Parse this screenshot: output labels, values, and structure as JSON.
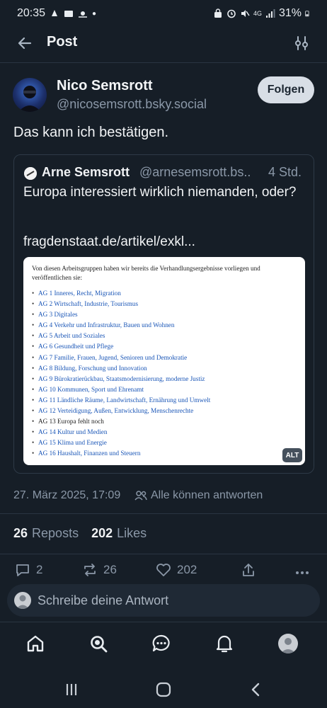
{
  "status_bar": {
    "time": "20:35",
    "battery": "31%",
    "network": "4G"
  },
  "header": {
    "title": "Post"
  },
  "post": {
    "author_name": "Nico Semsrott",
    "author_handle": "@nicosemsrott.bsky.social",
    "follow_label": "Folgen",
    "text": "Das kann ich bestätigen.",
    "date": "27. März 2025, 17:09",
    "reply_setting": "Alle können antworten",
    "reposts_count": "26",
    "reposts_label": "Reposts",
    "likes_count": "202",
    "likes_label": "Likes"
  },
  "quote": {
    "author_name": "Arne Semsrott",
    "author_handle": "@arnesemsrott.bs..",
    "time": "4 Std.",
    "text": "Europa interessiert wirklich niemanden, oder?",
    "link": "fragdenstaat.de/artikel/exkl...",
    "alt_badge": "ALT",
    "image": {
      "intro": "Von diesen Arbeitsgruppen haben wir bereits die Verhandlungsergebnisse vorliegen und veröffentlichen sie:",
      "items": [
        "AG 1 Inneres, Recht, Migration",
        "AG 2 Wirtschaft, Industrie, Tourismus",
        "AG 3 Digitales",
        "AG 4 Verkehr und Infrastruktur, Bauen und Wohnen",
        "AG 5 Arbeit und Soziales",
        "AG 6 Gesundheit und Pflege",
        "AG 7 Familie, Frauen, Jugend, Senioren und Demokratie",
        "AG 8 Bildung, Forschung und Innovation",
        "AG 9 Bürokratierückbau, Staatsmodernisierung, moderne Justiz",
        "AG 10 Kommunen, Sport und Ehrenamt",
        "AG 11 Ländliche Räume, Landwirtschaft, Ernährung und Umwelt",
        "AG 12 Verteidigung, Außen, Entwicklung, Menschenrechte",
        "AG 13 Europa fehlt noch",
        "AG 14 Kultur und Medien",
        "AG 15 Klima und Energie",
        "AG 16 Haushalt, Finanzen und Steuern"
      ]
    }
  },
  "actions": {
    "replies": "2",
    "reposts": "26",
    "likes": "202"
  },
  "reply_bar": {
    "placeholder": "Schreibe deine Antwort"
  },
  "colors": {
    "background": "#161e27",
    "text": "#f1f3f5",
    "muted": "#8b98a8",
    "link": "#1a56b7",
    "follow_button": "#d8dee6"
  },
  "icons": {
    "back": "arrow-left-icon",
    "filter": "sliders-icon",
    "home": "home-icon",
    "search": "search-icon",
    "chat": "chat-icon",
    "notifications": "bell-icon"
  }
}
